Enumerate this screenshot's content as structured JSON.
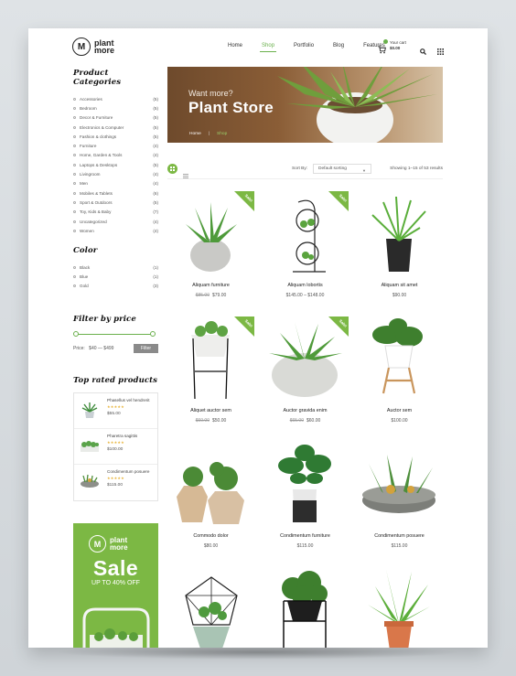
{
  "brand": {
    "logo_letter": "M",
    "name_line1": "plant",
    "name_line2": "more"
  },
  "nav": [
    {
      "label": "Home",
      "active": false
    },
    {
      "label": "Shop",
      "active": true
    },
    {
      "label": "Portfolio",
      "active": false
    },
    {
      "label": "Blog",
      "active": false
    },
    {
      "label": "Features",
      "active": false
    }
  ],
  "cart": {
    "label": "Your cart",
    "total": "$0.00"
  },
  "categories": {
    "title": "Product Categories",
    "items": [
      {
        "name": "Accessories",
        "count": "(5)"
      },
      {
        "name": "Bedroom",
        "count": "(5)"
      },
      {
        "name": "Decor & Furniture",
        "count": "(5)"
      },
      {
        "name": "Electronics & Computer",
        "count": "(5)"
      },
      {
        "name": "Fashion & clothings",
        "count": "(5)"
      },
      {
        "name": "Furniture",
        "count": "(4)"
      },
      {
        "name": "Home, Garden & Tools",
        "count": "(4)"
      },
      {
        "name": "Laptops & Desktops",
        "count": "(5)"
      },
      {
        "name": "Livingroom",
        "count": "(4)"
      },
      {
        "name": "Men",
        "count": "(4)"
      },
      {
        "name": "Mobiles & Tablets",
        "count": "(6)"
      },
      {
        "name": "Sport & Outdoors",
        "count": "(5)"
      },
      {
        "name": "Toy, Kids & Baby",
        "count": "(7)"
      },
      {
        "name": "Uncategorized",
        "count": "(4)"
      },
      {
        "name": "Women",
        "count": "(4)"
      }
    ]
  },
  "colors": {
    "title": "Color",
    "items": [
      {
        "name": "Black",
        "count": "(1)"
      },
      {
        "name": "Blue",
        "count": "(1)"
      },
      {
        "name": "Gold",
        "count": "(3)"
      }
    ]
  },
  "price_filter": {
    "title": "Filter by price",
    "label": "Price:",
    "range": "$40 — $499",
    "button": "Filter"
  },
  "top_rated": {
    "title": "Top rated products",
    "items": [
      {
        "name": "Phasellus vel hendrerit",
        "stars": "★★★★★",
        "price": "$55.00"
      },
      {
        "name": "Pharetra sagittis",
        "stars": "★★★★★",
        "price": "$100.00"
      },
      {
        "name": "Condimentum posuere",
        "stars": "★★★★★",
        "price": "$115.00"
      }
    ]
  },
  "promo": {
    "letter": "M",
    "brand_line1": "plant",
    "brand_line2": "more",
    "sale": "Sale",
    "off": "UP TO 40% OFF"
  },
  "hero": {
    "subtitle": "Want more?",
    "title": "Plant Store",
    "crumb_home": "Home",
    "crumb_sep": "|",
    "crumb_current": "Shop"
  },
  "toolbar": {
    "sort_label": "Sort By:",
    "sort_value": "Default sorting",
    "results": "Showing 1–15 of 53 results"
  },
  "products": [
    {
      "name": "Aliquam furniture",
      "old_price": "$85.00",
      "price": "$79.00",
      "sale": true
    },
    {
      "name": "Aliquam lobortis",
      "old_price": "",
      "price": "$145.00 – $148.00",
      "sale": true
    },
    {
      "name": "Aliquam sit amet",
      "old_price": "",
      "price": "$90.00",
      "sale": false
    },
    {
      "name": "Aliquet auctor sem",
      "old_price": "$60.00",
      "price": "$50.00",
      "sale": true
    },
    {
      "name": "Auctor gravida enim",
      "old_price": "$65.00",
      "price": "$60.00",
      "sale": true
    },
    {
      "name": "Auctor sem",
      "old_price": "",
      "price": "$100.00",
      "sale": false
    },
    {
      "name": "Commodo dolor",
      "old_price": "",
      "price": "$80.00",
      "sale": false
    },
    {
      "name": "Condimentum furniture",
      "old_price": "",
      "price": "$115.00",
      "sale": false
    },
    {
      "name": "Condimentum posuere",
      "old_price": "",
      "price": "$115.00",
      "sale": false
    }
  ],
  "sale_badge": "Sale!",
  "colors_theme": {
    "accent": "#7cb844",
    "star": "#e8b43a"
  }
}
